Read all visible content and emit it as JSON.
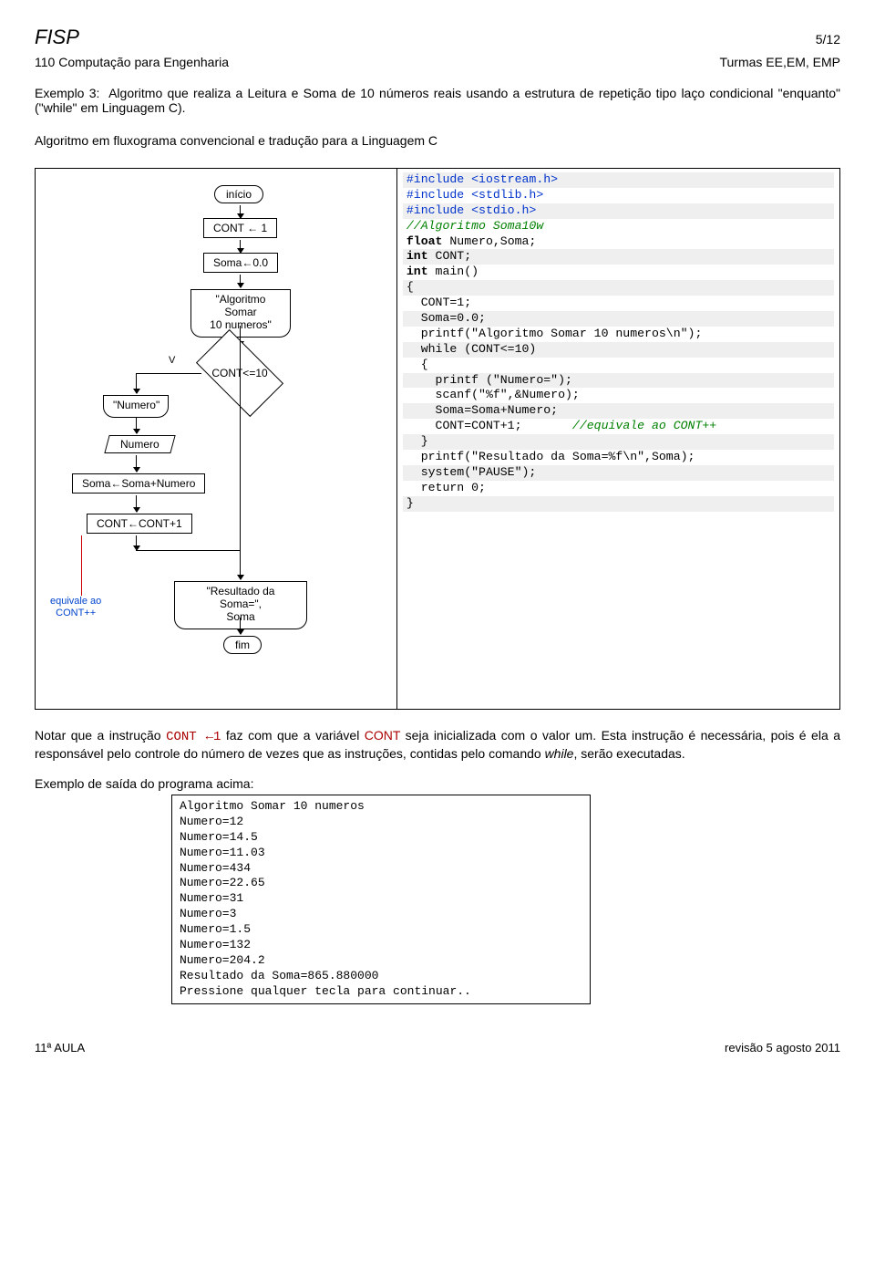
{
  "header": {
    "fisp": "FISP",
    "page": "5/12",
    "course": "110 Computação para Engenharia",
    "turmas": "Turmas EE,EM, EMP"
  },
  "exemplo": {
    "label": "Exemplo 3:",
    "text": "Algoritmo que realiza a Leitura e Soma de 10 números reais usando a estrutura de repetição tipo laço condicional \"enquanto\" (\"while\" em Linguagem C)."
  },
  "alg_sub": "Algoritmo em fluxograma convencional e tradução para a Linguagem C",
  "flow": {
    "inicio": "início",
    "cont1": "CONT ← 1",
    "soma0": "Soma←0.0",
    "algosomar_l1": "\"Algoritmo Somar",
    "algosomar_l2": "10 numeros\"",
    "v": "V",
    "cond": "CONT<=10",
    "numero_prompt": "\"Numero\"",
    "numero_in": "Numero",
    "soma_add": "Soma←Soma+Numero",
    "cont_inc": "CONT←CONT+1",
    "equiv_l1": "equivale ao",
    "equiv_l2": "CONT++",
    "result_l1": "\"Resultado da Soma=\",",
    "result_l2": "Soma",
    "fim": "fim"
  },
  "code": [
    {
      "t": "#include <iostream.h>",
      "cls": "stripe cblue"
    },
    {
      "t": "#include <stdlib.h>",
      "cls": "cblue"
    },
    {
      "t": "#include <stdio.h>",
      "cls": "stripe cblue"
    },
    {
      "t": "//Algoritmo Soma10w",
      "cls": "cgreen"
    },
    {
      "t": "float Numero,Soma;",
      "cls": "",
      "kw": "float"
    },
    {
      "t": "int CONT;",
      "cls": "stripe",
      "kw": "int"
    },
    {
      "t": "int main()",
      "cls": "",
      "kw": "int"
    },
    {
      "t": "{",
      "cls": "stripe"
    },
    {
      "t": "  CONT=1;",
      "cls": ""
    },
    {
      "t": "  Soma=0.0;",
      "cls": "stripe"
    },
    {
      "t": "  printf(\"Algoritmo Somar 10 numeros\\n\");",
      "cls": ""
    },
    {
      "t": "  while (CONT<=10)",
      "cls": "stripe"
    },
    {
      "t": "  {",
      "cls": ""
    },
    {
      "t": "    printf (\"Numero=\");",
      "cls": "stripe"
    },
    {
      "t": "    scanf(\"%f\",&Numero);",
      "cls": ""
    },
    {
      "t": "    Soma=Soma+Numero;",
      "cls": "stripe"
    },
    {
      "t": "    CONT=CONT+1;       //equivale ao CONT++",
      "cls": "",
      "comment": "//equivale ao CONT++"
    },
    {
      "t": "  }",
      "cls": "stripe"
    },
    {
      "t": "  printf(\"Resultado da Soma=%f\\n\",Soma);",
      "cls": ""
    },
    {
      "t": "  system(\"PAUSE\");",
      "cls": "stripe"
    },
    {
      "t": "  return 0;",
      "cls": ""
    },
    {
      "t": "}",
      "cls": "stripe"
    }
  ],
  "note": {
    "pre": "Notar que a instrução  ",
    "code_frag": "CONT ←1",
    "mid": " faz com que a variável ",
    "var": "CONT",
    "post": " seja inicializada com o valor um. Esta instrução é necessária, pois é ela a responsável pelo controle do número de vezes que as instruções, contidas pelo comando ",
    "while": "while",
    "tail": ", serão executadas."
  },
  "out_label": "Exemplo de saída do programa acima:",
  "output": [
    "Algoritmo Somar 10 numeros",
    "Numero=12",
    "Numero=14.5",
    "Numero=11.03",
    "Numero=434",
    "Numero=22.65",
    "Numero=31",
    "Numero=3",
    "Numero=1.5",
    "Numero=132",
    "Numero=204.2",
    "Resultado da Soma=865.880000",
    "Pressione qualquer tecla para continuar.."
  ],
  "footer": {
    "left": "11ª AULA",
    "right": "revisão 5 agosto 2011"
  }
}
